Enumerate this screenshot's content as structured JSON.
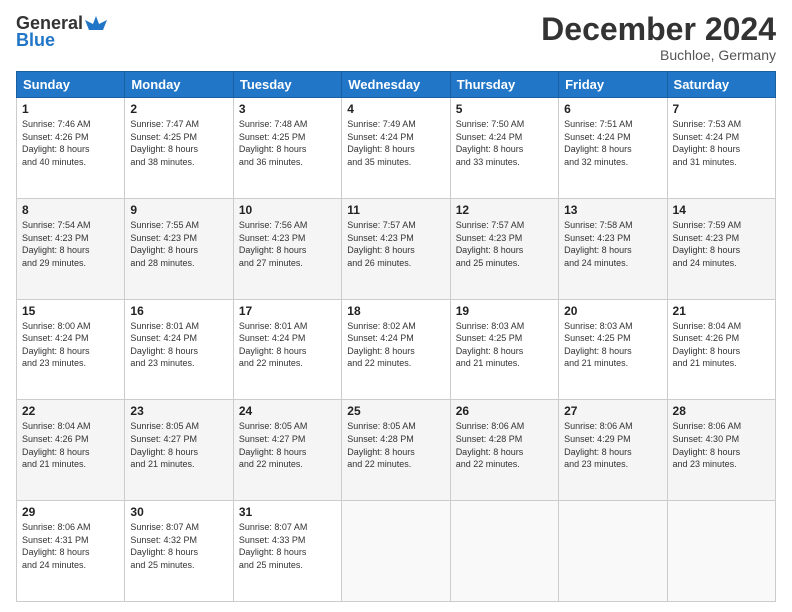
{
  "header": {
    "logo_general": "General",
    "logo_blue": "Blue",
    "month_title": "December 2024",
    "location": "Buchloe, Germany"
  },
  "days_of_week": [
    "Sunday",
    "Monday",
    "Tuesday",
    "Wednesday",
    "Thursday",
    "Friday",
    "Saturday"
  ],
  "weeks": [
    [
      {
        "day": "1",
        "sunrise": "7:46 AM",
        "sunset": "4:26 PM",
        "daylight": "8 hours and 40 minutes."
      },
      {
        "day": "2",
        "sunrise": "7:47 AM",
        "sunset": "4:25 PM",
        "daylight": "8 hours and 38 minutes."
      },
      {
        "day": "3",
        "sunrise": "7:48 AM",
        "sunset": "4:25 PM",
        "daylight": "8 hours and 36 minutes."
      },
      {
        "day": "4",
        "sunrise": "7:49 AM",
        "sunset": "4:24 PM",
        "daylight": "8 hours and 35 minutes."
      },
      {
        "day": "5",
        "sunrise": "7:50 AM",
        "sunset": "4:24 PM",
        "daylight": "8 hours and 33 minutes."
      },
      {
        "day": "6",
        "sunrise": "7:51 AM",
        "sunset": "4:24 PM",
        "daylight": "8 hours and 32 minutes."
      },
      {
        "day": "7",
        "sunrise": "7:53 AM",
        "sunset": "4:24 PM",
        "daylight": "8 hours and 31 minutes."
      }
    ],
    [
      {
        "day": "8",
        "sunrise": "7:54 AM",
        "sunset": "4:23 PM",
        "daylight": "8 hours and 29 minutes."
      },
      {
        "day": "9",
        "sunrise": "7:55 AM",
        "sunset": "4:23 PM",
        "daylight": "8 hours and 28 minutes."
      },
      {
        "day": "10",
        "sunrise": "7:56 AM",
        "sunset": "4:23 PM",
        "daylight": "8 hours and 27 minutes."
      },
      {
        "day": "11",
        "sunrise": "7:57 AM",
        "sunset": "4:23 PM",
        "daylight": "8 hours and 26 minutes."
      },
      {
        "day": "12",
        "sunrise": "7:57 AM",
        "sunset": "4:23 PM",
        "daylight": "8 hours and 25 minutes."
      },
      {
        "day": "13",
        "sunrise": "7:58 AM",
        "sunset": "4:23 PM",
        "daylight": "8 hours and 24 minutes."
      },
      {
        "day": "14",
        "sunrise": "7:59 AM",
        "sunset": "4:23 PM",
        "daylight": "8 hours and 24 minutes."
      }
    ],
    [
      {
        "day": "15",
        "sunrise": "8:00 AM",
        "sunset": "4:24 PM",
        "daylight": "8 hours and 23 minutes."
      },
      {
        "day": "16",
        "sunrise": "8:01 AM",
        "sunset": "4:24 PM",
        "daylight": "8 hours and 23 minutes."
      },
      {
        "day": "17",
        "sunrise": "8:01 AM",
        "sunset": "4:24 PM",
        "daylight": "8 hours and 22 minutes."
      },
      {
        "day": "18",
        "sunrise": "8:02 AM",
        "sunset": "4:24 PM",
        "daylight": "8 hours and 22 minutes."
      },
      {
        "day": "19",
        "sunrise": "8:03 AM",
        "sunset": "4:25 PM",
        "daylight": "8 hours and 21 minutes."
      },
      {
        "day": "20",
        "sunrise": "8:03 AM",
        "sunset": "4:25 PM",
        "daylight": "8 hours and 21 minutes."
      },
      {
        "day": "21",
        "sunrise": "8:04 AM",
        "sunset": "4:26 PM",
        "daylight": "8 hours and 21 minutes."
      }
    ],
    [
      {
        "day": "22",
        "sunrise": "8:04 AM",
        "sunset": "4:26 PM",
        "daylight": "8 hours and 21 minutes."
      },
      {
        "day": "23",
        "sunrise": "8:05 AM",
        "sunset": "4:27 PM",
        "daylight": "8 hours and 21 minutes."
      },
      {
        "day": "24",
        "sunrise": "8:05 AM",
        "sunset": "4:27 PM",
        "daylight": "8 hours and 22 minutes."
      },
      {
        "day": "25",
        "sunrise": "8:05 AM",
        "sunset": "4:28 PM",
        "daylight": "8 hours and 22 minutes."
      },
      {
        "day": "26",
        "sunrise": "8:06 AM",
        "sunset": "4:28 PM",
        "daylight": "8 hours and 22 minutes."
      },
      {
        "day": "27",
        "sunrise": "8:06 AM",
        "sunset": "4:29 PM",
        "daylight": "8 hours and 23 minutes."
      },
      {
        "day": "28",
        "sunrise": "8:06 AM",
        "sunset": "4:30 PM",
        "daylight": "8 hours and 23 minutes."
      }
    ],
    [
      {
        "day": "29",
        "sunrise": "8:06 AM",
        "sunset": "4:31 PM",
        "daylight": "8 hours and 24 minutes."
      },
      {
        "day": "30",
        "sunrise": "8:07 AM",
        "sunset": "4:32 PM",
        "daylight": "8 hours and 25 minutes."
      },
      {
        "day": "31",
        "sunrise": "8:07 AM",
        "sunset": "4:33 PM",
        "daylight": "8 hours and 25 minutes."
      },
      null,
      null,
      null,
      null
    ]
  ]
}
